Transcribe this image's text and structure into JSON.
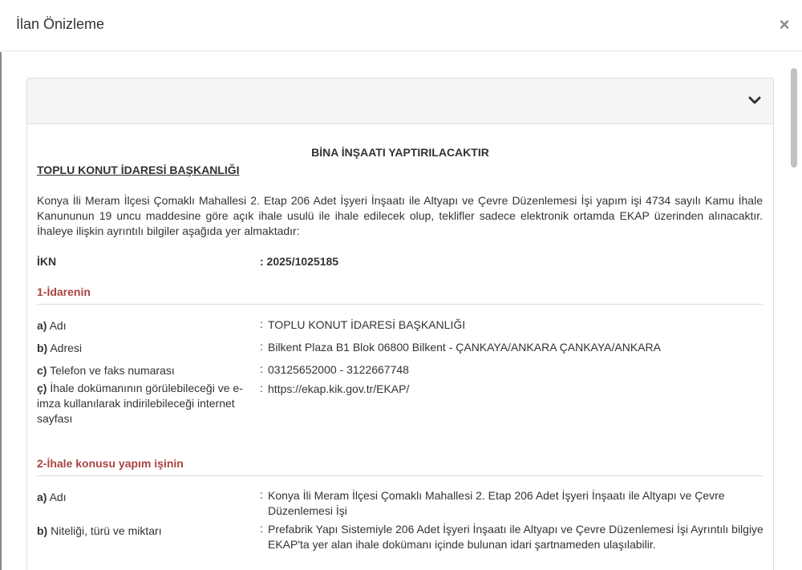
{
  "modal": {
    "title": "İlan Önizleme",
    "close_symbol": "×"
  },
  "panel": {
    "toggle_icon": "chevron-down-icon"
  },
  "doc": {
    "title": "BİNA İNŞAATI YAPTIRILACAKTIR",
    "organization": "TOPLU KONUT İDARESİ BAŞKANLIĞI",
    "intro": "Konya İli Meram İlçesi Çomaklı Mahallesi 2. Etap 206 Adet İşyeri İnşaatı ile Altyapı ve Çevre Düzenlemesi İşi yapım işi 4734 sayılı Kamu İhale Kanununun 19 uncu maddesine göre açık ihale usulü ile ihale edilecek olup, teklifler sadece elektronik ortamda EKAP üzerinden alınacaktır.  İhaleye ilişkin ayrıntılı bilgiler aşağıda yer almaktadır:",
    "ikn_label": "İKN",
    "ikn_value": ": 2025/1025185"
  },
  "section1": {
    "title": "1-İdarenin",
    "rows": [
      {
        "key": "a)",
        "label": "Adı",
        "value": "TOPLU KONUT İDARESİ BAŞKANLIĞI"
      },
      {
        "key": "b)",
        "label": "Adresi",
        "value": "Bilkent Plaza B1 Blok 06800 Bilkent - ÇANKAYA/ANKARA ÇANKAYA/ANKARA"
      },
      {
        "key": "c)",
        "label": "Telefon ve faks numarası",
        "value": "03125652000 - 3122667748"
      },
      {
        "key": "ç)",
        "label": "İhale dokümanının görülebileceği ve e-imza kullanılarak indirilebileceği internet sayfası",
        "value": "https://ekap.kik.gov.tr/EKAP/"
      }
    ]
  },
  "section2": {
    "title": "2-İhale konusu yapım işinin",
    "rows": [
      {
        "key": "a)",
        "label": "Adı",
        "value": "Konya İli Meram İlçesi Çomaklı Mahallesi 2. Etap 206 Adet İşyeri İnşaatı ile Altyapı ve Çevre Düzenlemesi İşi"
      },
      {
        "key": "b)",
        "label": "Niteliği, türü ve miktarı",
        "value": "Prefabrik Yapı Sistemiyle 206 Adet İşyeri İnşaatı ile Altyapı ve Çevre Düzenlemesi İşi Ayrıntılı bilgiye EKAP'ta yer alan ihale dokümanı içinde bulunan idari şartnameden ulaşılabilir."
      }
    ]
  },
  "colon": ":"
}
